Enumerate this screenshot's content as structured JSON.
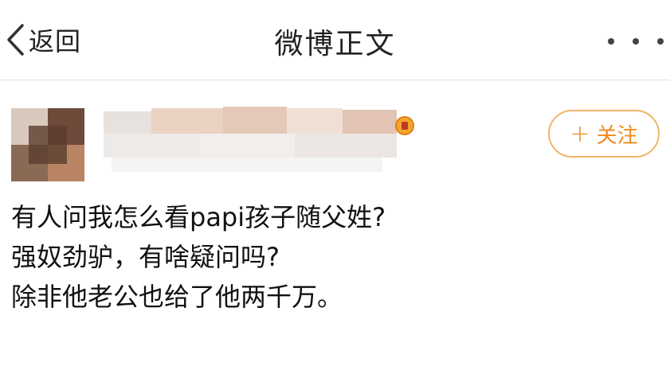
{
  "header": {
    "back_label": "返回",
    "title": "微博正文",
    "more_icon": "more-dots-icon"
  },
  "author": {
    "follow_label": "关注",
    "follow_icon": "plus-icon"
  },
  "post": {
    "lines": [
      "有人问我怎么看papi孩子随父姓?",
      "强奴劲驴，有啥疑问吗?",
      "除非他老公也给了他两千万。"
    ]
  },
  "colors": {
    "accent": "#f08a1c",
    "follow_border": "#f0b46a",
    "divider": "#dedede"
  }
}
